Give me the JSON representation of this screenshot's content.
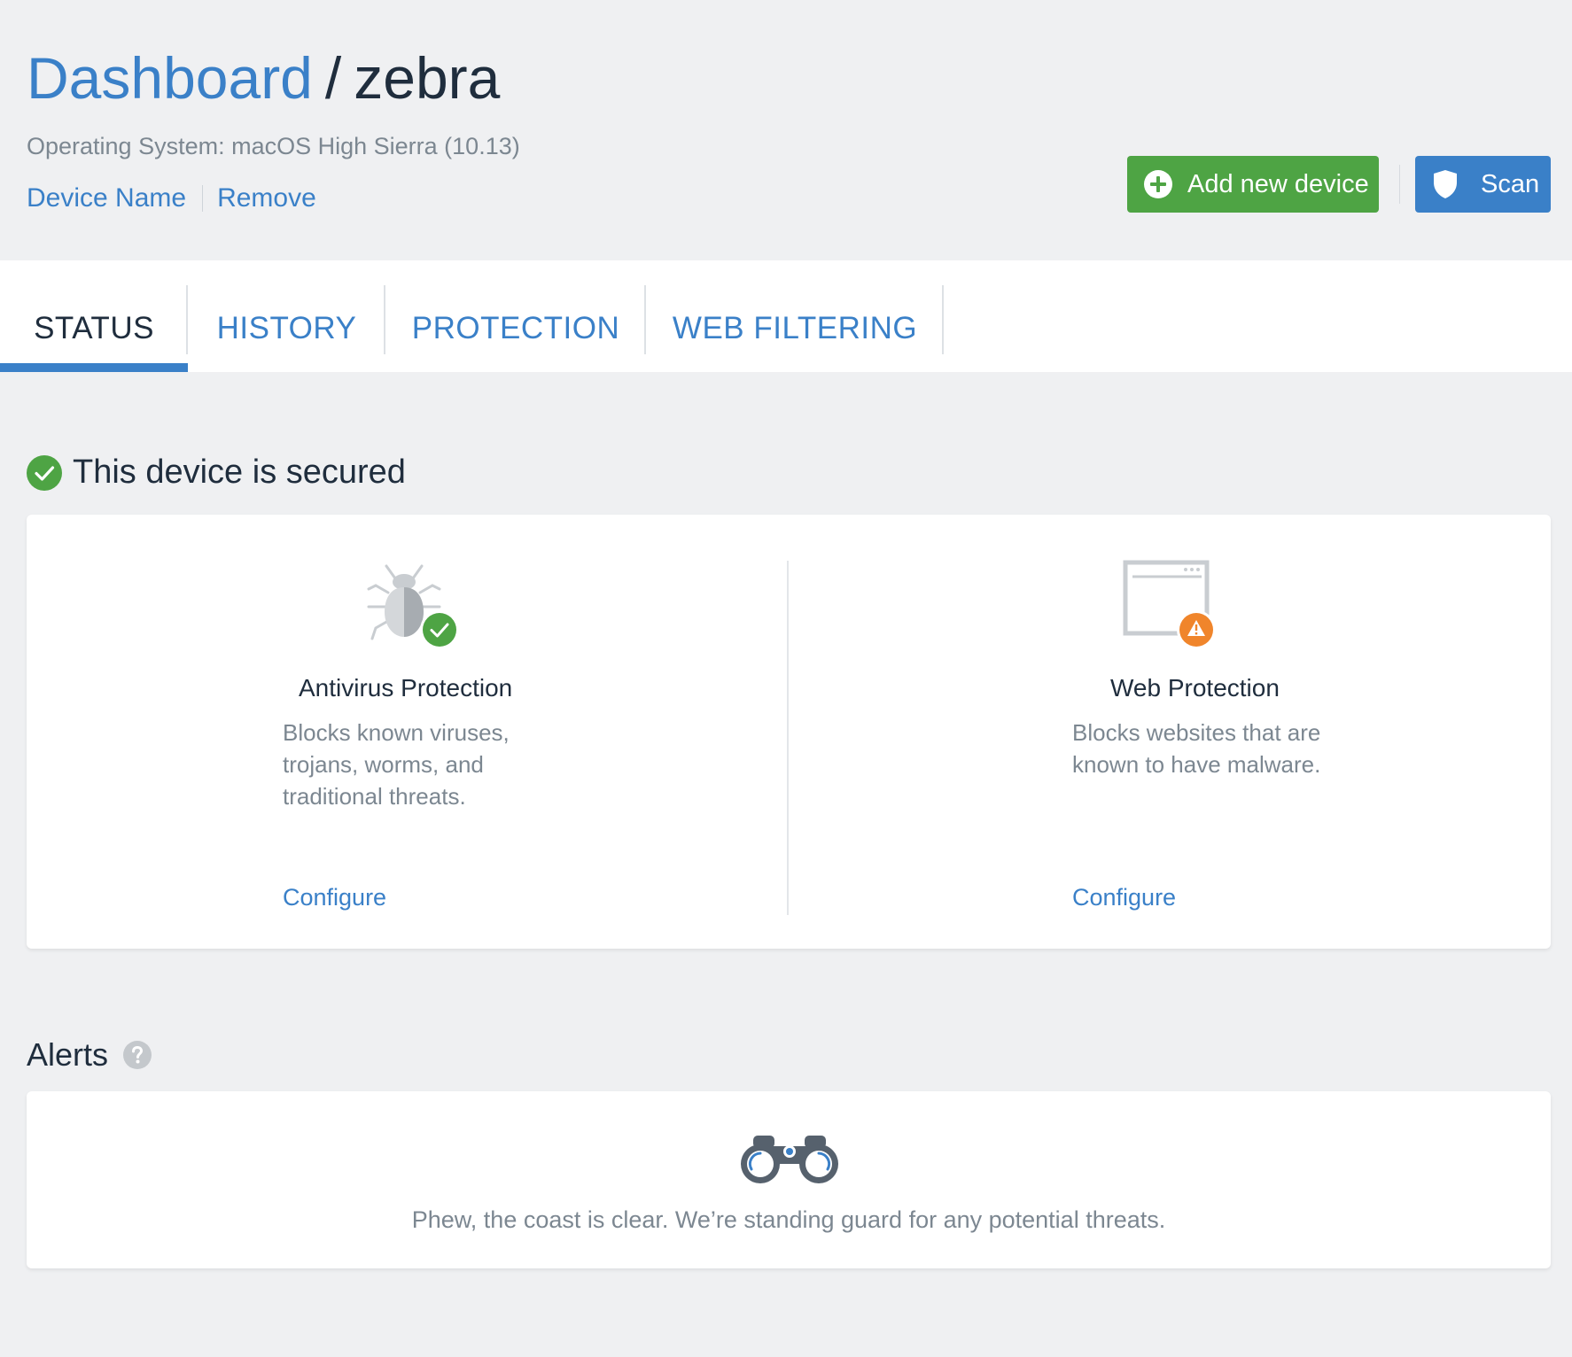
{
  "header": {
    "breadcrumb_root": "Dashboard",
    "breadcrumb_separator": "/",
    "breadcrumb_current": "zebra",
    "os_info": "Operating System: macOS High Sierra (10.13)",
    "links": {
      "device_name": "Device Name",
      "remove": "Remove"
    },
    "buttons": {
      "add_device": "Add new device",
      "scan": "Scan"
    }
  },
  "tabs": [
    {
      "label": "STATUS",
      "active": true
    },
    {
      "label": "HISTORY",
      "active": false
    },
    {
      "label": "PROTECTION",
      "active": false
    },
    {
      "label": "WEB FILTERING",
      "active": false
    }
  ],
  "status": {
    "heading": "This device is secured",
    "features": [
      {
        "icon": "bug-icon",
        "badge": "check-badge-icon",
        "title": "Antivirus Protection",
        "description": "Blocks known viruses, trojans, worms, and traditional threats.",
        "link": "Configure"
      },
      {
        "icon": "browser-window-icon",
        "badge": "warning-badge-icon",
        "title": "Web Protection",
        "description": "Blocks websites that are known to have malware.",
        "link": "Configure"
      }
    ]
  },
  "alerts": {
    "heading": "Alerts",
    "empty_icon": "binoculars-icon",
    "empty_message": "Phew, the coast is clear. We’re standing guard for any potential threats."
  },
  "colors": {
    "accent_blue": "#3a80c8",
    "success_green": "#4ea444",
    "warning_orange": "#f0852b",
    "background": "#eff0f2"
  }
}
